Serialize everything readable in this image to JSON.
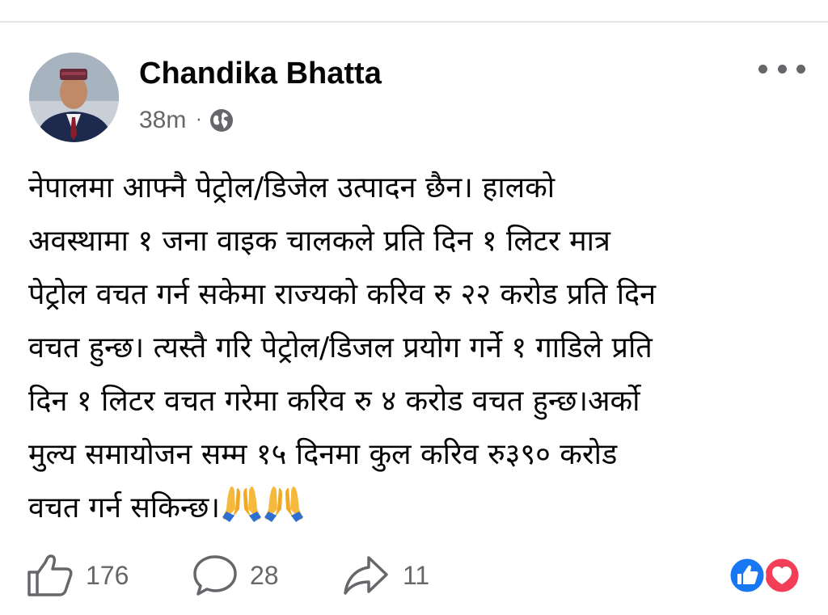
{
  "post": {
    "author": "Chandika Bhatta",
    "time": "38m",
    "separator": "·",
    "privacy_icon": "globe-icon",
    "body_lines": [
      "नेपालमा आफ्नै पेट्रोल/डिजेल उत्पादन छैन। हालको",
      "अवस्थामा १ जना वाइक चालकले प्रति दिन १ लिटर मात्र",
      "पेट्रोल वचत गर्न सकेमा राज्यको करिव रु २२ करोड प्रति दिन",
      "वचत हुन्छ। त्यस्तै गरि पेट्रोल/डिजल प्रयोग गर्ने १ गाडिले प्रति",
      "दिन १ लिटर वचत गरेमा करिव रु ४ करोड वचत हुन्छ।अर्को",
      "मुल्य समायोजन सम्म १५ दिनमा कुल करिव रु३९० करोड",
      "वचत गर्न सकिन्छ।"
    ],
    "emoji": [
      "folded-hands",
      "folded-hands"
    ]
  },
  "actions": {
    "likes": "176",
    "comments": "28",
    "shares": "11"
  },
  "reactions": [
    "like",
    "love"
  ],
  "colors": {
    "like_blue": "#1877f2",
    "love_red": "#f33e58",
    "secondary_text": "#65676b"
  }
}
